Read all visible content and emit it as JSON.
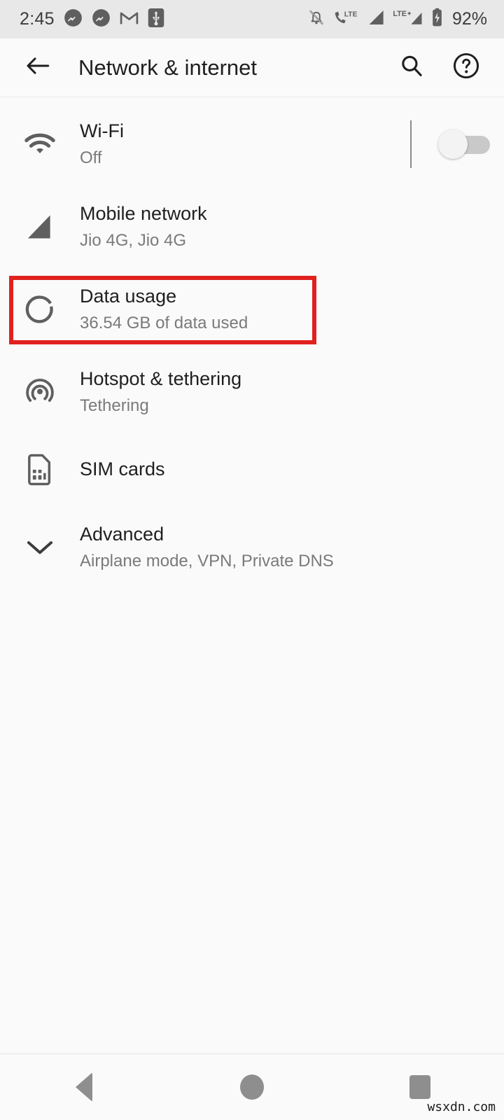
{
  "status_bar": {
    "time": "2:45",
    "battery_percent": "92%",
    "left_icons": [
      "messenger-icon",
      "messenger-icon",
      "gmail-icon",
      "usb-icon"
    ],
    "right_icons": [
      "notifications-off-icon",
      "volte-phone-icon",
      "signal-bars-icon",
      "lte-plus-signal-icon",
      "battery-charging-icon"
    ],
    "background": "#e8e8e8"
  },
  "app_bar": {
    "back_label": "back-arrow",
    "title": "Network & internet",
    "search_label": "search",
    "help_label": "help"
  },
  "settings": {
    "items": [
      {
        "icon": "wifi-icon",
        "title": "Wi-Fi",
        "subtitle": "Off",
        "has_toggle": true,
        "toggle_on": false
      },
      {
        "icon": "signal-cellular-icon",
        "title": "Mobile network",
        "subtitle": "Jio 4G, Jio 4G",
        "has_toggle": false
      },
      {
        "icon": "data-usage-icon",
        "title": "Data usage",
        "subtitle": "36.54 GB of data used",
        "has_toggle": false,
        "highlighted": true
      },
      {
        "icon": "hotspot-icon",
        "title": "Hotspot & tethering",
        "subtitle": "Tethering",
        "has_toggle": false
      },
      {
        "icon": "sim-card-icon",
        "title": "SIM cards",
        "subtitle": "",
        "has_toggle": false
      },
      {
        "icon": "chevron-down-icon",
        "title": "Advanced",
        "subtitle": "Airplane mode, VPN, Private DNS",
        "has_toggle": false
      }
    ]
  },
  "highlight": {
    "color": "#e0211f",
    "target": "Data usage"
  },
  "nav_bar": {
    "back": "nav-back-icon",
    "home": "nav-home-icon",
    "recents": "nav-recents-icon"
  },
  "watermark": {
    "text": "wsxdn.com"
  }
}
